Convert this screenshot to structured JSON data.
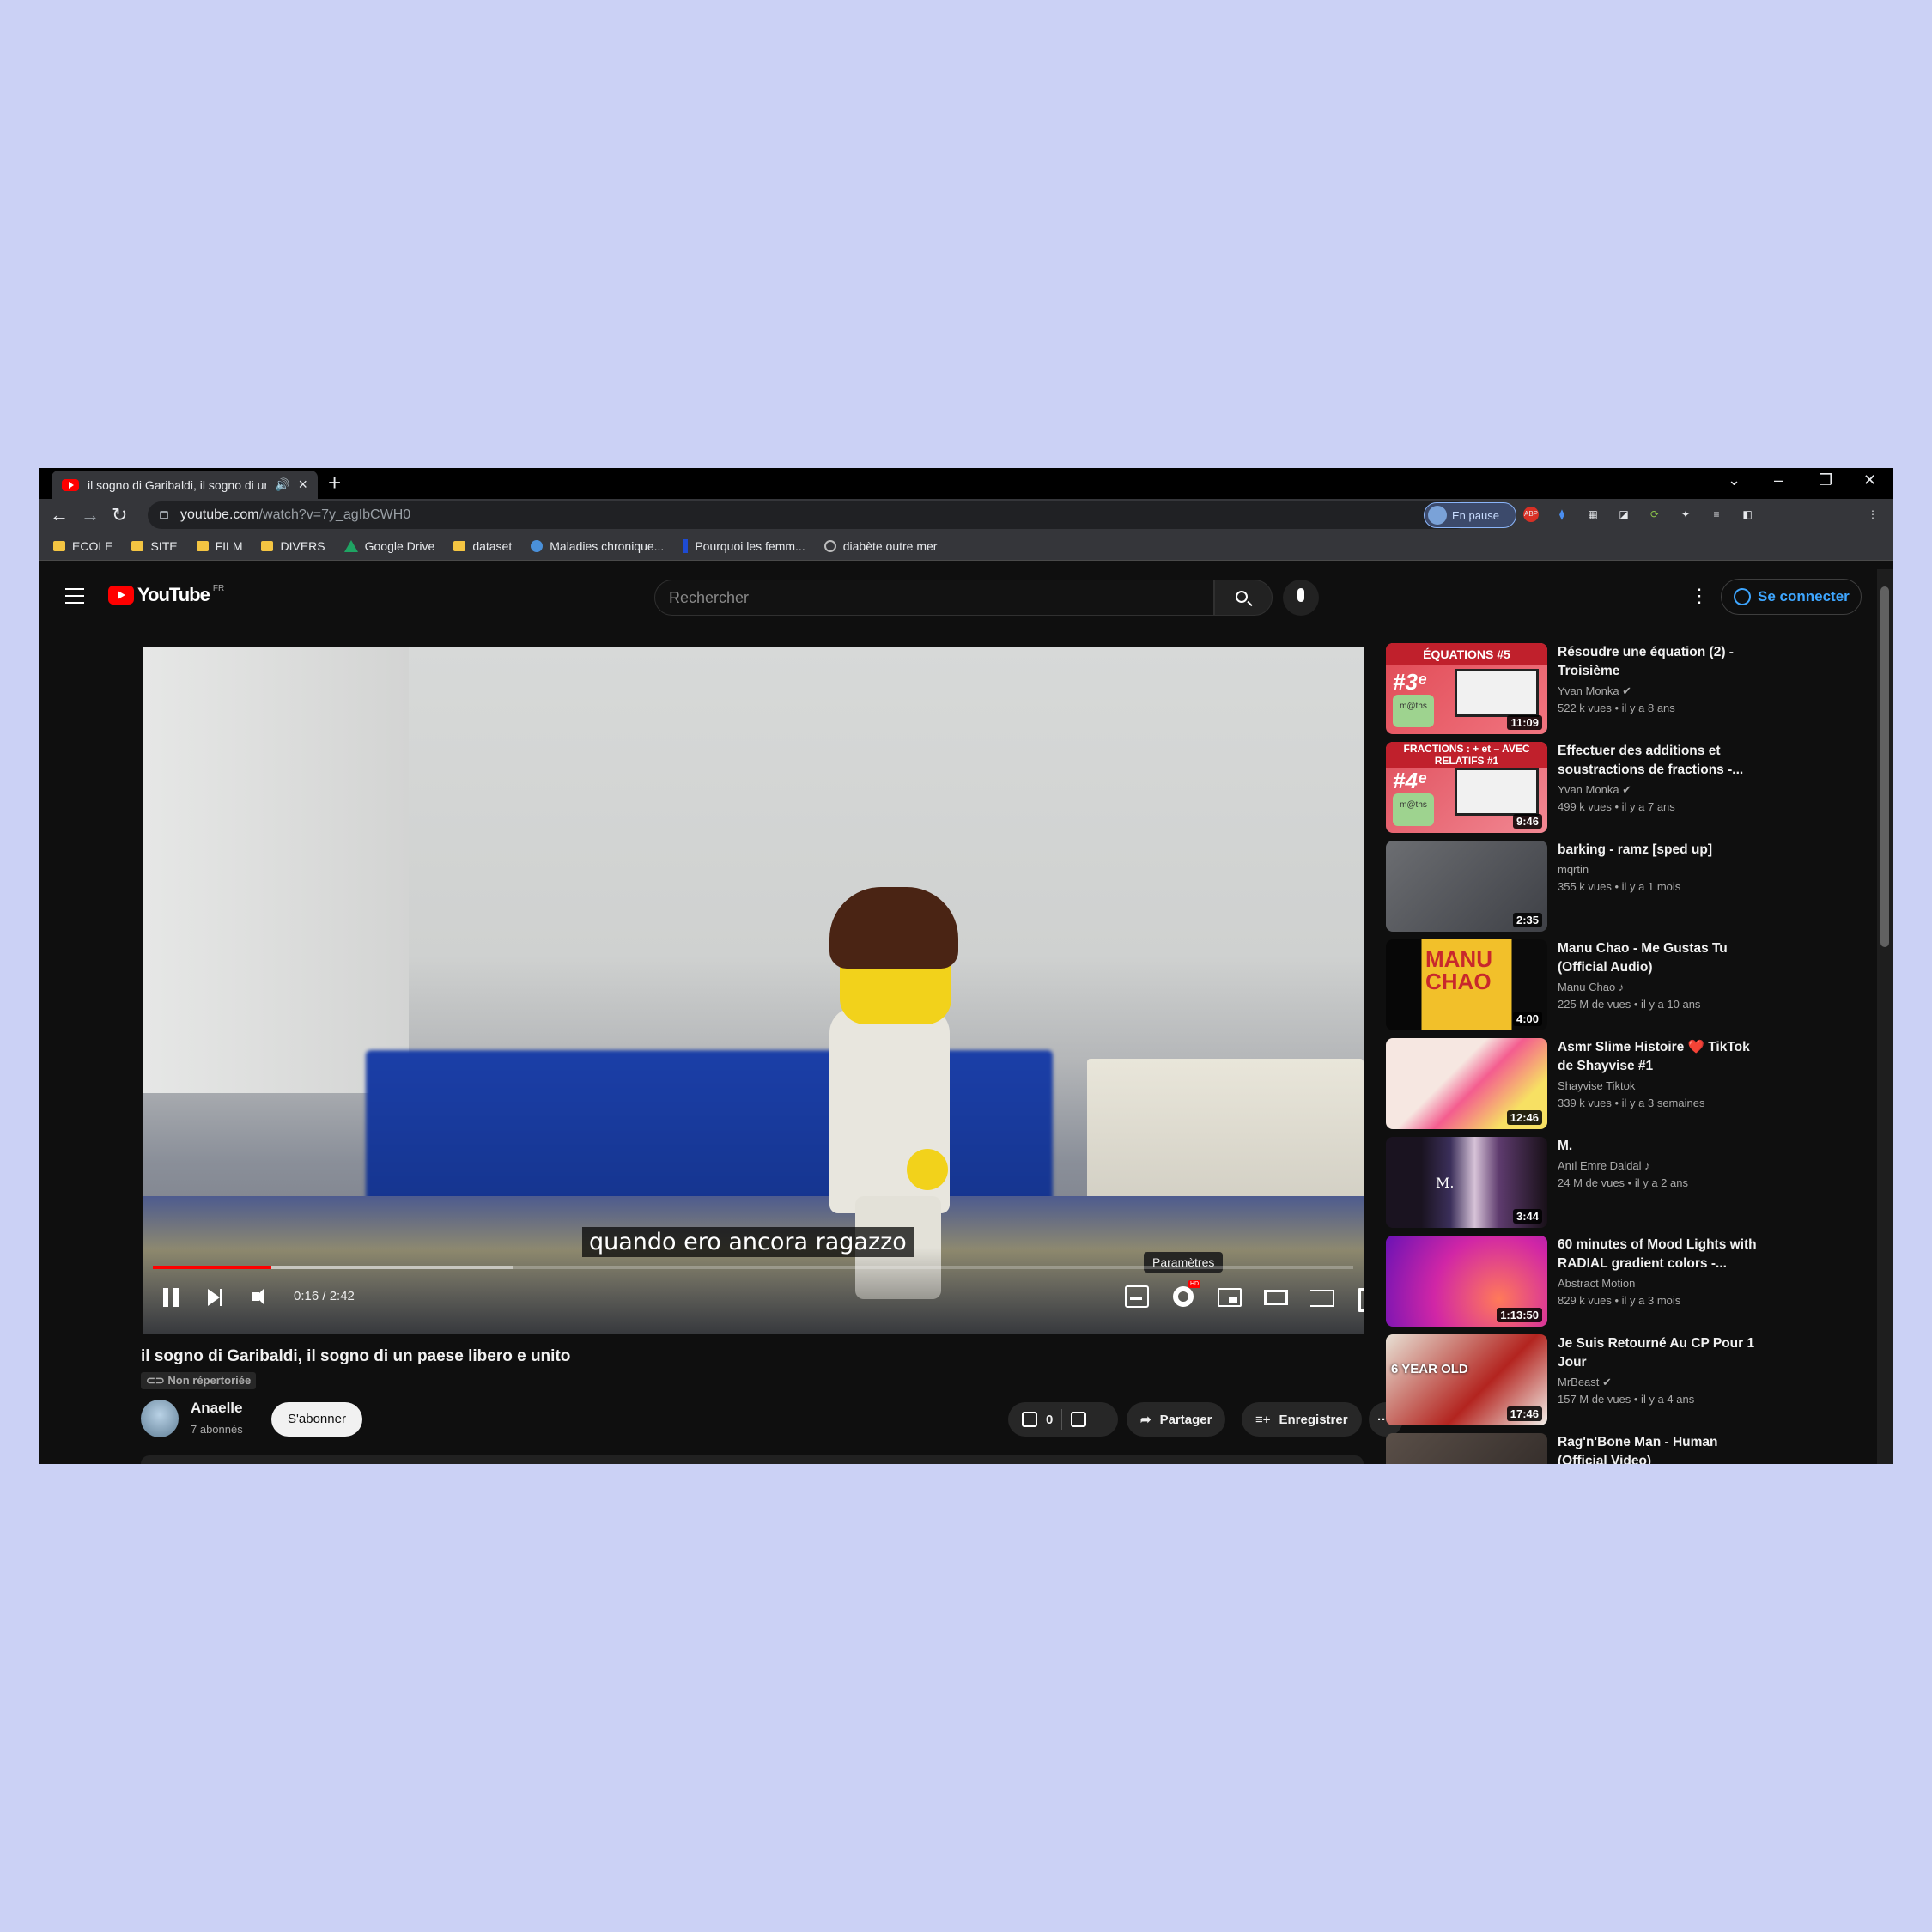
{
  "browser": {
    "tab_title": "il sogno di Garibaldi, il sogno di un paese libero e unito - YouTube",
    "url_host": "youtube.com",
    "url_path": "/watch?v=7y_agIbCWH0",
    "profile_status": "En pause",
    "extension_badge": "ABP",
    "bookmarks": [
      {
        "label": "ECOLE",
        "icon": "folder-icon"
      },
      {
        "label": "SITE",
        "icon": "folder-icon"
      },
      {
        "label": "FILM",
        "icon": "folder-icon"
      },
      {
        "label": "DIVERS",
        "icon": "folder-icon"
      },
      {
        "label": "Google Drive",
        "icon": "google-drive-icon"
      },
      {
        "label": "dataset",
        "icon": "folder-icon"
      },
      {
        "label": "Maladies chronique...",
        "icon": "site-icon"
      },
      {
        "label": "Pourquoi les femm...",
        "icon": "site-icon"
      },
      {
        "label": "diabète outre mer",
        "icon": "globe-icon"
      }
    ]
  },
  "header": {
    "logo_text": "YouTube",
    "country_code": "FR",
    "search_placeholder": "Rechercher",
    "signin_label": "Se connecter"
  },
  "player": {
    "subtitle": "quando ero ancora ragazzo",
    "tooltip": "Paramètres",
    "time": "0:16 / 2:42",
    "progress_fraction": 0.099,
    "buffered_fraction": 0.3,
    "hd_badge": "HD"
  },
  "video": {
    "title": "il sogno di Garibaldi, il sogno di un paese libero e unito",
    "visibility": "Non répertoriée",
    "channel": "Anaelle",
    "subscribers": "7 abonnés",
    "subscribe_label": "S'abonner",
    "likes": "0",
    "share_label": "Partager",
    "save_label": "Enregistrer"
  },
  "recommendations": [
    {
      "title": "Résoudre une équation (2) - Troisième",
      "channel": "Yvan Monka",
      "verified": true,
      "meta": "522 k vues • il y a 8 ans",
      "duration": "11:09",
      "thumb_text": "ÉQUATIONS #5"
    },
    {
      "title": "Effectuer des additions et soustractions de fractions -...",
      "channel": "Yvan Monka",
      "verified": true,
      "meta": "499 k vues • il y a 7 ans",
      "duration": "9:46",
      "thumb_text": "FRACTIONS : + et – AVEC RELATIFS #1"
    },
    {
      "title": "barking - ramz [sped up]",
      "channel": "mqrtin",
      "verified": false,
      "meta": "355 k vues • il y a 1 mois",
      "duration": "2:35",
      "thumb_text": ""
    },
    {
      "title": "Manu Chao - Me Gustas Tu (Official Audio)",
      "channel": "Manu Chao",
      "verified": false,
      "music": true,
      "meta": "225 M de vues • il y a 10 ans",
      "duration": "4:00",
      "thumb_text": "MANU CHAO"
    },
    {
      "title": "Asmr Slime Histoire ❤️ TikTok de Shayvise #1",
      "channel": "Shayvise Tiktok",
      "verified": false,
      "meta": "339 k vues • il y a 3 semaines",
      "duration": "12:46",
      "thumb_text": ""
    },
    {
      "title": "M.",
      "channel": "Anıl Emre Daldal",
      "verified": false,
      "music": true,
      "meta": "24 M de vues • il y a 2 ans",
      "duration": "3:44",
      "thumb_text": "M."
    },
    {
      "title": "60 minutes of Mood Lights with RADIAL gradient colors -...",
      "channel": "Abstract Motion",
      "verified": false,
      "meta": "829 k vues • il y a 3 mois",
      "duration": "1:13:50",
      "thumb_text": ""
    },
    {
      "title": "Je Suis Retourné Au CP Pour 1 Jour",
      "channel": "MrBeast",
      "verified": true,
      "meta": "157 M de vues • il y a 4 ans",
      "duration": "17:46",
      "thumb_text": "6 YEAR OLD"
    },
    {
      "title": "Rag'n'Bone Man - Human (Official Video)",
      "channel": "",
      "verified": false,
      "meta": "",
      "duration": "",
      "thumb_text": ""
    }
  ]
}
